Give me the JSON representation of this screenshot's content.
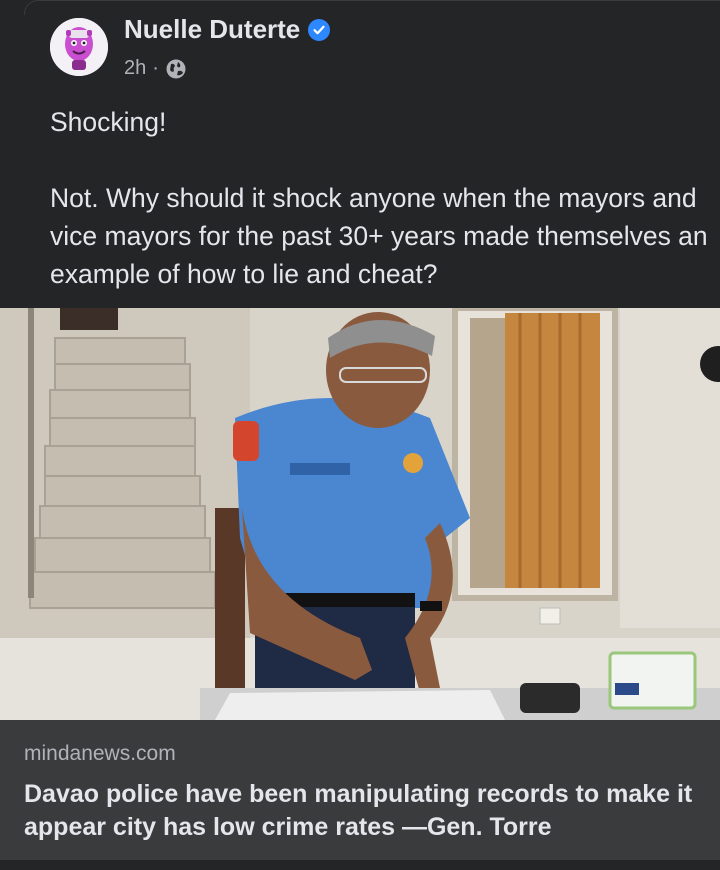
{
  "post": {
    "author": "Nuelle Duterte",
    "timestamp": "2h",
    "separator": "·",
    "audience_icon": "globe-icon",
    "verified_icon": "verified-badge-icon",
    "text_line_1": "Shocking!",
    "text_line_2": "Not. Why should it shock anyone when the mayors and vice mayors for the past 30+ years made themselves an example of how to lie and cheat?"
  },
  "link": {
    "domain": "mindanews.com",
    "headline": "Davao police have been manipulating records to make it appear city has low crime rates —Gen. Torre"
  },
  "colors": {
    "background": "#242526",
    "card": "#3a3b3c",
    "text": "#e4e6eb",
    "muted": "#b0b3b8",
    "verified": "#2d88ff"
  }
}
